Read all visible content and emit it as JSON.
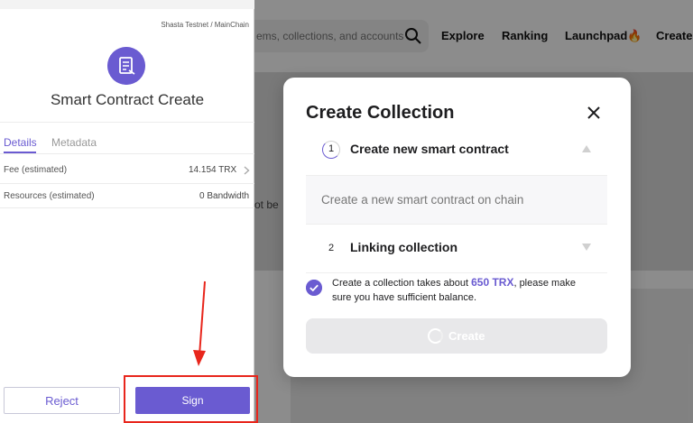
{
  "background": {
    "search": {
      "placeholder": "ems, collections, and accounts",
      "icon": "search-icon"
    },
    "nav": [
      {
        "label": "Explore"
      },
      {
        "label": "Ranking"
      },
      {
        "label": "Launchpad🔥"
      },
      {
        "label": "Create"
      }
    ],
    "hero_text": "ot be"
  },
  "modal": {
    "title": "Create Collection",
    "close_icon": "close-icon",
    "steps": [
      {
        "number": "1",
        "label": "Create new smart contract",
        "description": "Create a new smart contract on chain",
        "expanded": true
      },
      {
        "number": "2",
        "label": "Linking collection",
        "expanded": false
      }
    ],
    "note": {
      "before": "Create a collection takes about ",
      "amount": "650 TRX",
      "after": ", please make sure you have sufficient balance."
    },
    "create_label": "Create",
    "accent": "#6a5bd1"
  },
  "wallet": {
    "network": "Shasta Testnet / MainChain",
    "title": "Smart Contract Create",
    "tabs": [
      {
        "label": "Details",
        "active": true
      },
      {
        "label": "Metadata",
        "active": false
      }
    ],
    "rows": [
      {
        "label": "Fee (estimated)",
        "value": "14.154 TRX"
      },
      {
        "label": "Resources (estimated)",
        "value": "0 Bandwidth"
      }
    ],
    "reject_label": "Reject",
    "sign_label": "Sign",
    "accent": "#6a5bd1"
  },
  "annotation": {
    "color": "#e8261c"
  }
}
